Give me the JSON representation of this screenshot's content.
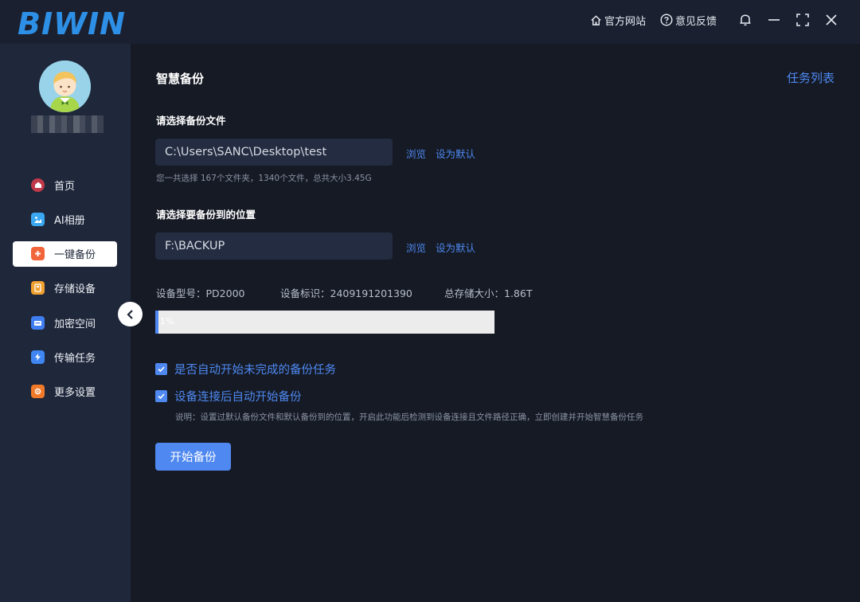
{
  "app": {
    "logo_text": "BIWIN",
    "official_site": "官方网站",
    "feedback": "意见反馈",
    "icons": [
      "home-icon",
      "help-circle-icon",
      "bell-icon",
      "minimize-icon",
      "fullscreen-icon",
      "close-icon"
    ]
  },
  "sidebar": {
    "items": [
      {
        "label": "首页",
        "icon": "home-icon",
        "color": "#c0394b"
      },
      {
        "label": "AI相册",
        "icon": "photo-album-icon",
        "color": "#3aa8f0"
      },
      {
        "label": "一键备份",
        "icon": "backup-icon",
        "color": "#f2643a",
        "active": true
      },
      {
        "label": "存储设备",
        "icon": "storage-device-icon",
        "color": "#f0a02f"
      },
      {
        "label": "加密空间",
        "icon": "encrypted-space-icon",
        "color": "#3f7ef0"
      },
      {
        "label": "传输任务",
        "icon": "transfer-task-icon",
        "color": "#3f86f3"
      },
      {
        "label": "更多设置",
        "icon": "more-settings-icon",
        "color": "#f07a2a"
      }
    ]
  },
  "main": {
    "title": "智慧备份",
    "task_list": "任务列表",
    "source": {
      "label": "请选择备份文件",
      "path": "C:\\Users\\SANC\\Desktop\\test",
      "browse": "浏览",
      "set_default": "设为默认",
      "summary": "您一共选择 167个文件夹，1340个文件，总共大小3.45G"
    },
    "destination": {
      "label": "请选择要备份到的位置",
      "path": "F:\\BACKUP",
      "browse": "浏览",
      "set_default": "设为默认"
    },
    "device": {
      "model": "设备型号：PD2000",
      "id": "设备标识：2409191201390",
      "capacity": "总存储大小：1.86T"
    },
    "progress": {
      "percent": 1,
      "label": "1%"
    },
    "options": {
      "auto_resume": "是否自动开始未完成的备份任务",
      "auto_resume_checked": true,
      "auto_start_on_connect": "设备连接后自动开始备份",
      "auto_start_on_connect_checked": true,
      "note": "说明：设置过默认备份文件和默认备份到的位置，开启此功能后检测到设备连接且文件路径正确，立即创建并开始智慧备份任务"
    },
    "start_button": "开始备份"
  },
  "colors": {
    "accent": "#4f88f0",
    "background": "#151a25",
    "sidebar": "#1f273a",
    "titlebar": "#1a2030"
  }
}
